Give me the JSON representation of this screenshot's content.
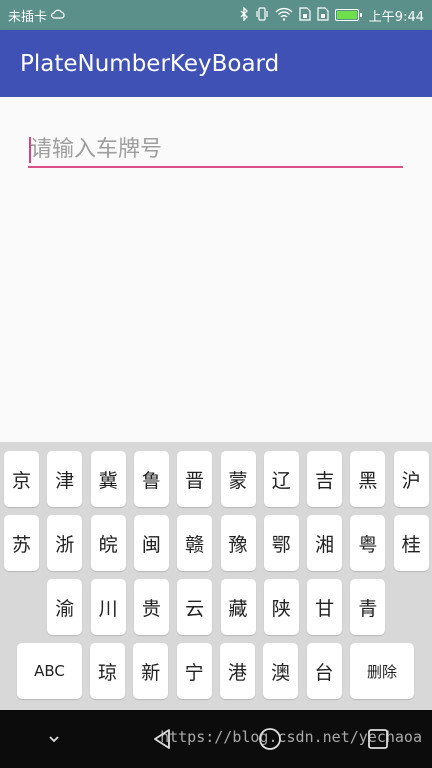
{
  "status_bar": {
    "carrier": "未插卡",
    "time": "上午9:44"
  },
  "app_bar": {
    "title": "PlateNumberKeyBoard"
  },
  "plate_input": {
    "placeholder": "请输入车牌号",
    "value": ""
  },
  "keyboard": {
    "row1": [
      "京",
      "津",
      "冀",
      "鲁",
      "晋",
      "蒙",
      "辽",
      "吉",
      "黑",
      "沪"
    ],
    "row2": [
      "苏",
      "浙",
      "皖",
      "闽",
      "赣",
      "豫",
      "鄂",
      "湘",
      "粤",
      "桂"
    ],
    "row3": [
      "渝",
      "川",
      "贵",
      "云",
      "藏",
      "陕",
      "甘",
      "青"
    ],
    "row4": {
      "abc": "ABC",
      "keys": [
        "琼",
        "新",
        "宁",
        "港",
        "澳",
        "台"
      ],
      "delete": "删除"
    }
  },
  "watermark": "https://blog.csdn.net/yechaoa",
  "colors": {
    "status_bar": "#5a8f8a",
    "app_bar": "#3f51b5",
    "accent": "#d94f86",
    "keyboard_bg": "#d8d8d8",
    "nav_bar": "#0c0c0c"
  },
  "icons": {
    "status": [
      "bluetooth-icon",
      "vibrate-icon",
      "wifi-icon",
      "sim-icon",
      "battery-icon"
    ],
    "nav": [
      "chevron-down-icon",
      "back-icon",
      "home-icon",
      "recents-icon"
    ]
  }
}
